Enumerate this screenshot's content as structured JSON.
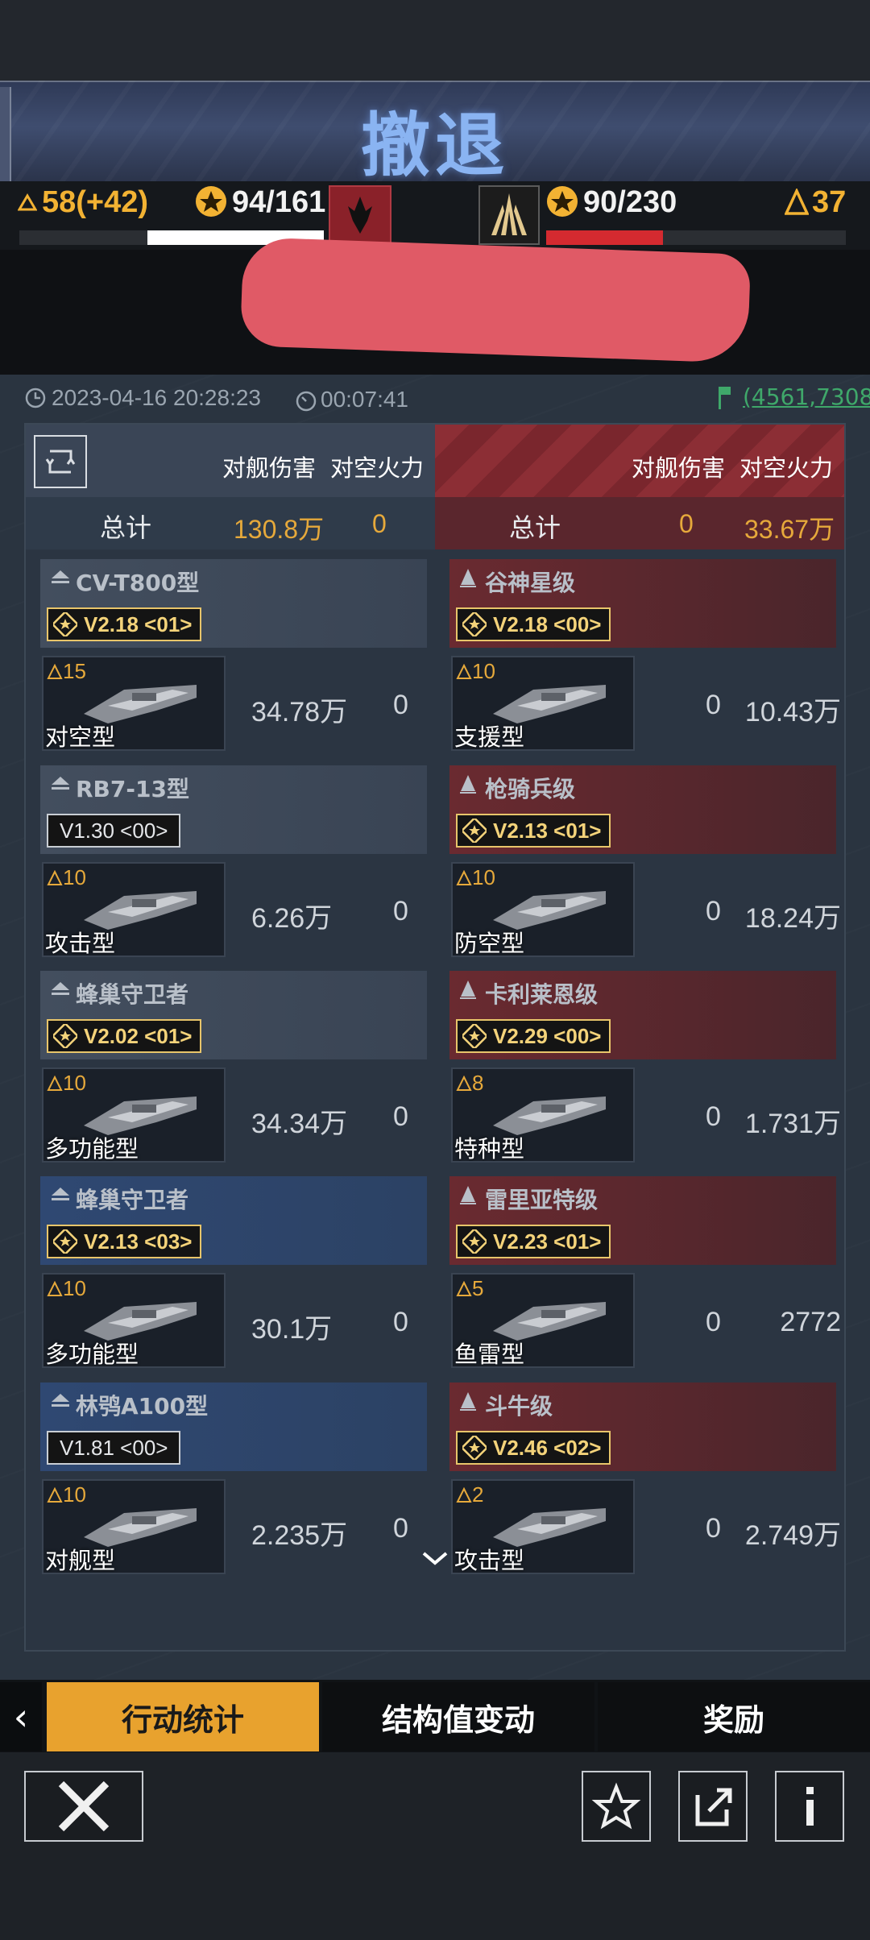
{
  "header": {
    "title": "撤退",
    "left_power": "58(+42)",
    "left_score": "94/161",
    "right_score": "90/230",
    "right_power": "37",
    "left_bar_fill": 0.58,
    "right_bar_fill": 0.39
  },
  "meta": {
    "datetime": "2023-04-16 20:28:23",
    "duration": "00:07:41",
    "coords": "(4561,7308)"
  },
  "columns": {
    "ship_damage": "对舰伤害",
    "anti_air": "对空火力"
  },
  "totals": {
    "label": "总计",
    "left_damage": "130.8万",
    "left_aa": "0",
    "right_damage": "0",
    "right_aa": "33.67万"
  },
  "left_ships": [
    {
      "name": "CV-T800型",
      "version": "V2.18  <01>",
      "version_style": "gold",
      "level": "15",
      "type": "对空型",
      "damage": "34.78万",
      "aa": "0"
    },
    {
      "name": "RB7-13型",
      "version": "V1.30  <00>",
      "version_style": "plain",
      "level": "10",
      "type": "攻击型",
      "damage": "6.26万",
      "aa": "0"
    },
    {
      "name": "蜂巢守卫者",
      "version": "V2.02  <01>",
      "version_style": "gold",
      "level": "10",
      "type": "多功能型",
      "damage": "34.34万",
      "aa": "0"
    },
    {
      "name": "蜂巢守卫者",
      "version": "V2.13  <03>",
      "version_style": "gold",
      "level": "10",
      "type": "多功能型",
      "damage": "30.1万",
      "aa": "0"
    },
    {
      "name": "林鸮A100型",
      "version": "V1.81  <00>",
      "version_style": "plain",
      "level": "10",
      "type": "对舰型",
      "damage": "2.235万",
      "aa": "0"
    }
  ],
  "right_ships": [
    {
      "name": "谷神星级",
      "version": "V2.18  <00>",
      "level": "10",
      "type": "支援型",
      "damage": "0",
      "aa": "10.43万"
    },
    {
      "name": "枪骑兵级",
      "version": "V2.13  <01>",
      "level": "10",
      "type": "防空型",
      "damage": "0",
      "aa": "18.24万"
    },
    {
      "name": "卡利莱恩级",
      "version": "V2.29  <00>",
      "level": "8",
      "type": "特种型",
      "damage": "0",
      "aa": "1.731万"
    },
    {
      "name": "雷里亚特级",
      "version": "V2.23  <01>",
      "level": "5",
      "type": "鱼雷型",
      "damage": "0",
      "aa": "2772"
    },
    {
      "name": "斗牛级",
      "version": "V2.46  <02>",
      "level": "2",
      "type": "攻击型",
      "damage": "0",
      "aa": "2.749万"
    }
  ],
  "tabs": [
    "行动统计",
    "结构值变动",
    "奖励"
  ],
  "nav": {
    "back": "‹"
  }
}
